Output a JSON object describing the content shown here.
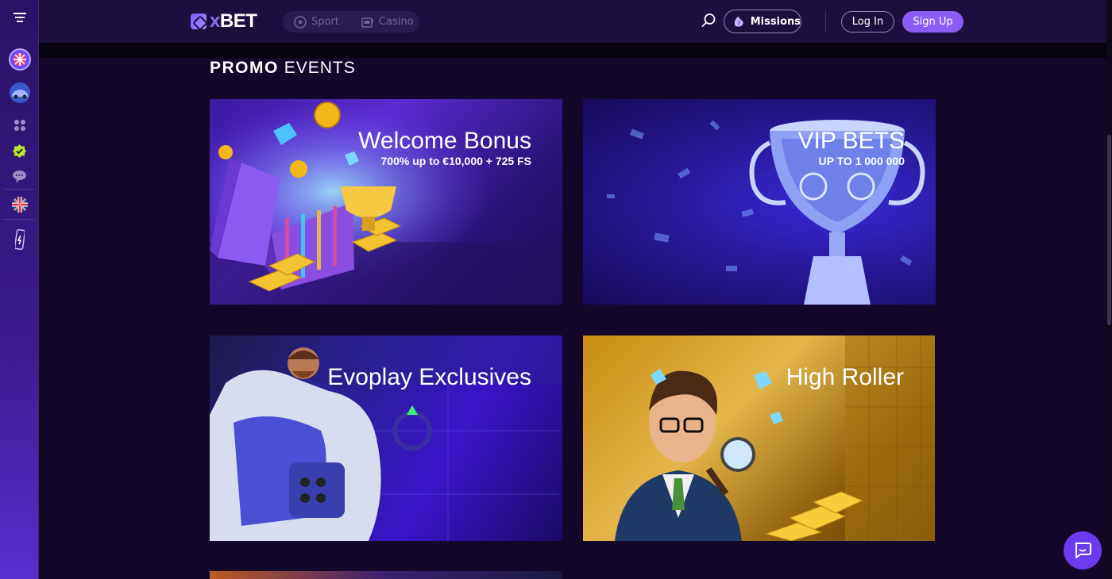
{
  "header": {
    "logo": {
      "prefix": "",
      "x": "x",
      "suffix": "BET"
    },
    "modes": [
      {
        "label": "Sport",
        "icon": "soccer-ball-icon"
      },
      {
        "label": "Casino",
        "icon": "slot-machine-icon"
      }
    ],
    "missions_label": "Missions",
    "login_label": "Log In",
    "signup_label": "Sign Up"
  },
  "sidebar": {
    "items": [
      {
        "icon": "menu-icon"
      },
      {
        "icon": "wheel-of-fortune-icon"
      },
      {
        "icon": "car-icon"
      },
      {
        "icon": "games-grid-icon"
      },
      {
        "icon": "badge-check-icon"
      },
      {
        "icon": "chat-bubble-icon"
      },
      {
        "icon": "uk-flag-icon"
      },
      {
        "icon": "mobile-app-icon"
      }
    ]
  },
  "page": {
    "title_bold": "PROMO",
    "title_light": "EVENTS"
  },
  "promos": [
    {
      "title": "Welcome Bonus",
      "subtitle": "700% up to €10,000 + 725 FS"
    },
    {
      "title": "VIP BETS",
      "subtitle": "UP TO 1 000 000"
    },
    {
      "title": "Evoplay Exclusives",
      "subtitle": ""
    },
    {
      "title": "High Roller",
      "subtitle": ""
    }
  ],
  "colors": {
    "accent": "#8b5cf6",
    "background": "#14082a",
    "header": "#1d0f3d",
    "chat": "#6c3bf0"
  }
}
